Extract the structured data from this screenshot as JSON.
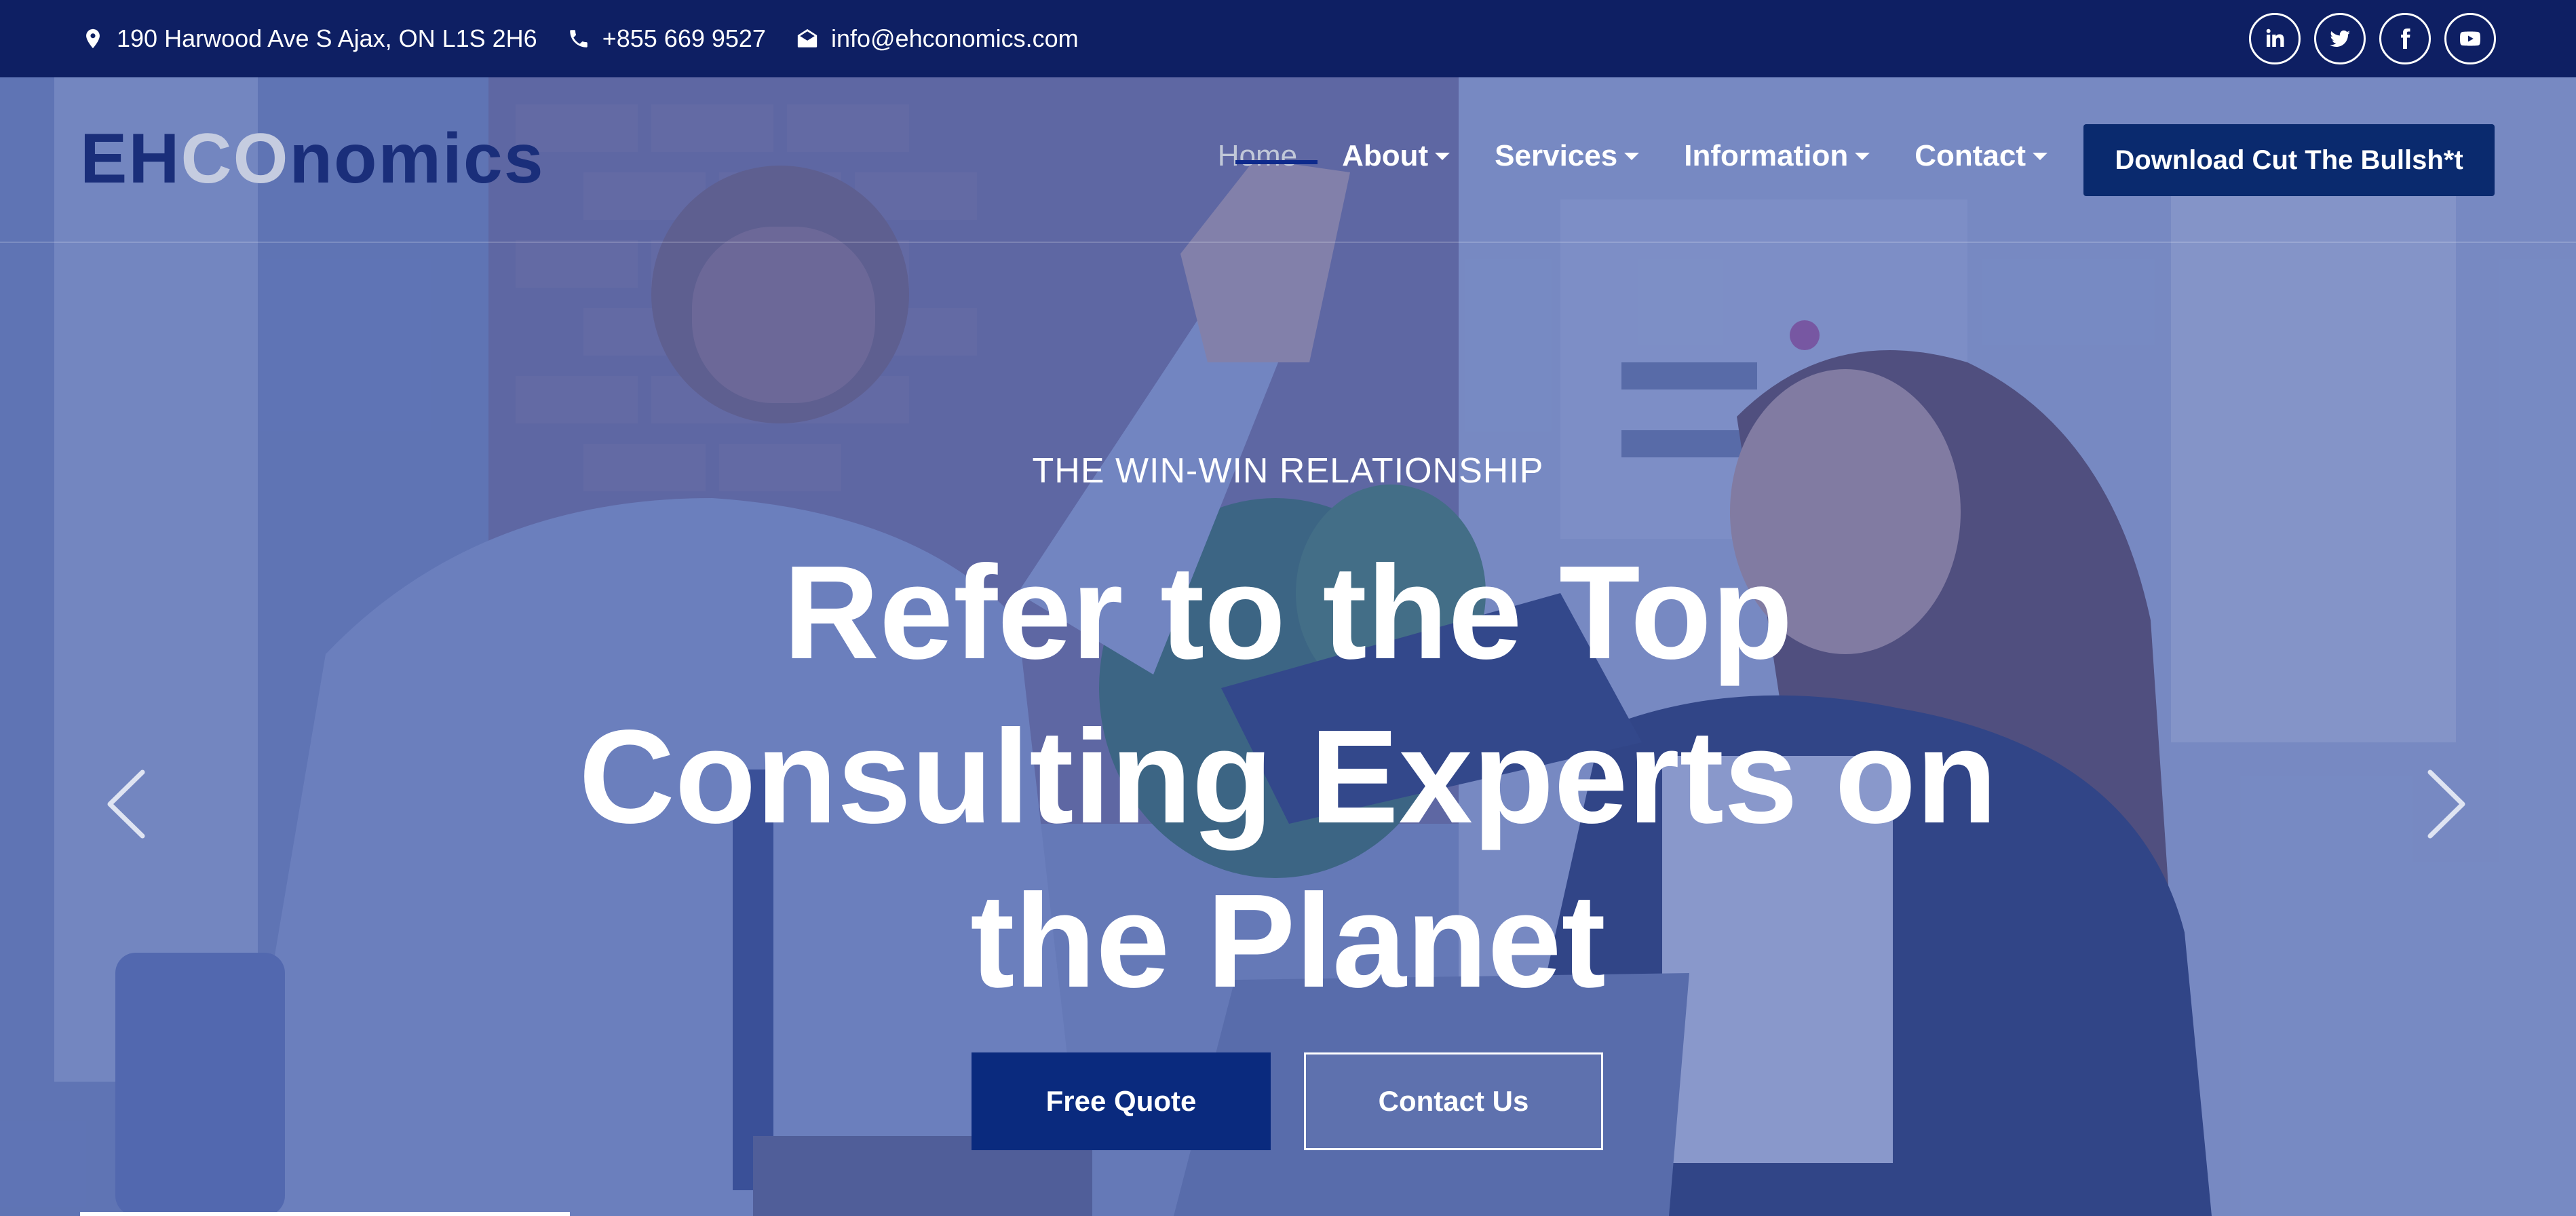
{
  "topbar": {
    "address": "190 Harwood Ave S Ajax, ON L1S 2H6",
    "phone": "+855 669 9527",
    "email": "info@ehconomics.com",
    "socials": [
      "linkedin-icon",
      "twitter-icon",
      "facebook-icon",
      "youtube-icon"
    ]
  },
  "logo": {
    "part1": "EH",
    "part2": "CO",
    "part3": "nomics"
  },
  "nav": {
    "items": [
      {
        "label": "Home",
        "active": true
      },
      {
        "label": "About",
        "has_dropdown": true
      },
      {
        "label": "Services",
        "has_dropdown": true
      },
      {
        "label": "Information",
        "has_dropdown": true
      },
      {
        "label": "Contact",
        "has_dropdown": true
      }
    ],
    "cta_label": "Download Cut The Bullsh*t"
  },
  "hero": {
    "kicker": "THE WIN-WIN RELATIONSHIP",
    "headline_line1": "Refer to the Top",
    "headline_line2": "Consulting Experts on",
    "headline_line3": "the Planet",
    "primary_button": "Free Quote",
    "secondary_button": "Contact Us"
  },
  "colors": {
    "topbar_bg": "#0e1f63",
    "brand_navy": "#0a2a7e",
    "overlay": "#3a54a8",
    "white": "#ffffff"
  }
}
